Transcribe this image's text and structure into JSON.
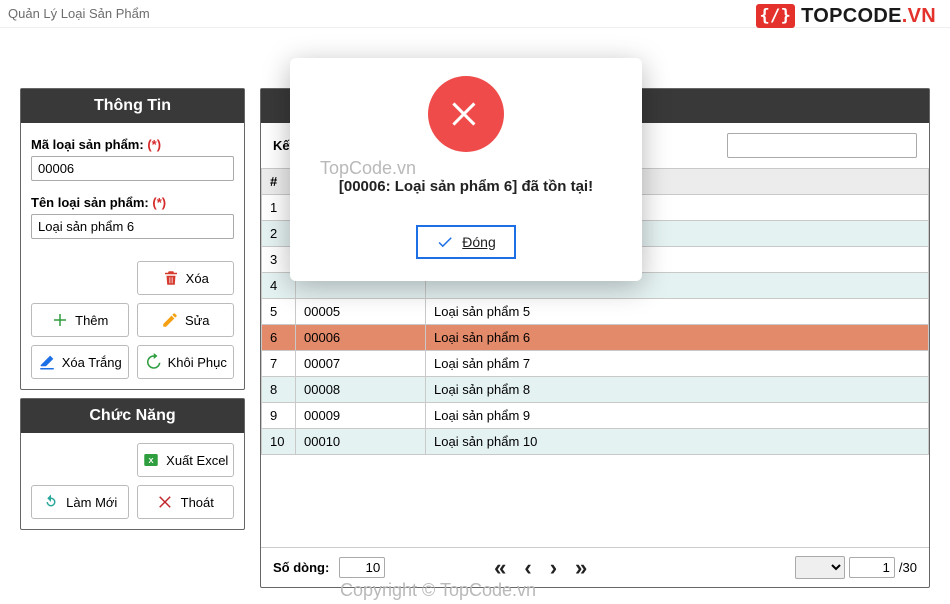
{
  "window": {
    "title": "Quản Lý Loại Sản Phẩm"
  },
  "brand": {
    "logo": "{/}",
    "name": "TOPCODE",
    "tld": ".VN"
  },
  "sidebar": {
    "info_header": "Thông Tin",
    "code_label": "Mã loại sản phẩm:",
    "code_value": "00006",
    "name_label": "Tên loại sản phẩm:",
    "name_value": "Loại sản phẩm 6",
    "required": "(*)",
    "buttons": {
      "delete": "Xóa",
      "add": "Thêm",
      "edit": "Sửa",
      "clear": "Xóa Trắng",
      "restore": "Khôi Phục"
    },
    "func_header": "Chức Năng",
    "func_buttons": {
      "export": "Xuất Excel",
      "refresh": "Làm Mới",
      "exit": "Thoát"
    }
  },
  "main": {
    "search_label": "Kết",
    "search_value": "",
    "columns": {
      "idx": "#",
      "code": "",
      "name": ""
    },
    "rows": [
      {
        "idx": "1",
        "code": "",
        "name": ""
      },
      {
        "idx": "2",
        "code": "",
        "name": ""
      },
      {
        "idx": "3",
        "code": "",
        "name": ""
      },
      {
        "idx": "4",
        "code": "",
        "name": ""
      },
      {
        "idx": "5",
        "code": "00005",
        "name": "Loại sản phẩm 5"
      },
      {
        "idx": "6",
        "code": "00006",
        "name": "Loại sản phẩm 6"
      },
      {
        "idx": "7",
        "code": "00007",
        "name": "Loại sản phẩm 7"
      },
      {
        "idx": "8",
        "code": "00008",
        "name": "Loại sản phẩm 8"
      },
      {
        "idx": "9",
        "code": "00009",
        "name": "Loại sản phẩm 9"
      },
      {
        "idx": "10",
        "code": "00010",
        "name": "Loại sản phẩm 10"
      }
    ],
    "selected_index": 6,
    "pager": {
      "rows_label": "Số dòng:",
      "rows_value": "10",
      "page_value": "1",
      "page_total": "/30"
    }
  },
  "modal": {
    "message": "[00006: Loại sản phẩm 6] đã tồn tại!",
    "close_label": "Đóng"
  },
  "watermarks": {
    "w1": "TopCode.vn",
    "w2": "Copyright © TopCode.vn"
  }
}
